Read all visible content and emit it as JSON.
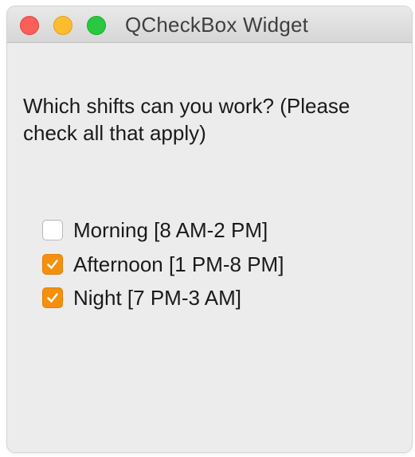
{
  "window": {
    "title": "QCheckBox Widget"
  },
  "question": "Which shifts can you work? (Please check all that apply)",
  "options": [
    {
      "label": "Morning [8 AM-2 PM]",
      "checked": false
    },
    {
      "label": "Afternoon [1 PM-8 PM]",
      "checked": true
    },
    {
      "label": "Night [7 PM-3 AM]",
      "checked": true
    }
  ],
  "colors": {
    "accent": "#f5900e",
    "close": "#fc5f57",
    "minimize": "#fdbc2e",
    "zoom": "#28c840"
  },
  "icons": {
    "check": "checkmark-icon"
  }
}
